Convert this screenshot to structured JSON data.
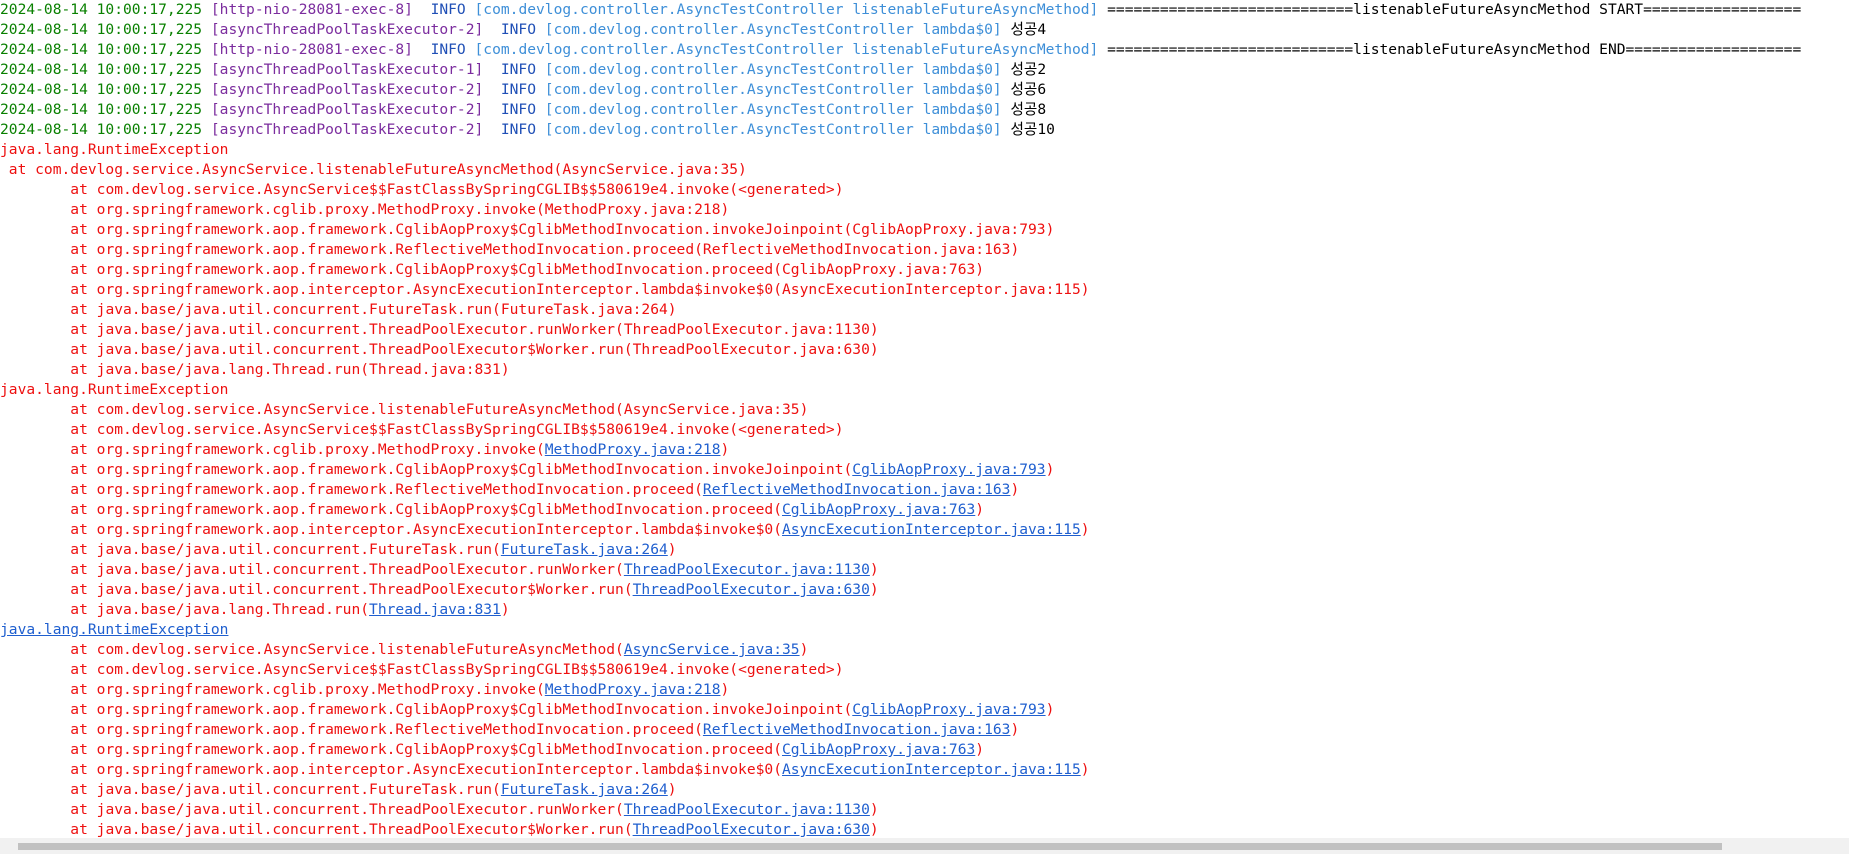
{
  "log": [
    {
      "ts": "2024-08-14 10:00:17,225",
      "thread": "[http-nio-28081-exec-8]",
      "level": "INFO",
      "logger": "[com.devlog.controller.AsyncTestController listenableFutureAsyncMethod]",
      "msg": "============================listenableFutureAsyncMethod START=================="
    },
    {
      "ts": "2024-08-14 10:00:17,225",
      "thread": "[asyncThreadPoolTaskExecutor-2]",
      "level": "INFO",
      "logger": "[com.devlog.controller.AsyncTestController lambda$0]",
      "msg": "성공4"
    },
    {
      "ts": "2024-08-14 10:00:17,225",
      "thread": "[http-nio-28081-exec-8]",
      "level": "INFO",
      "logger": "[com.devlog.controller.AsyncTestController listenableFutureAsyncMethod]",
      "msg": "============================listenableFutureAsyncMethod END===================="
    },
    {
      "ts": "2024-08-14 10:00:17,225",
      "thread": "[asyncThreadPoolTaskExecutor-1]",
      "level": "INFO",
      "logger": "[com.devlog.controller.AsyncTestController lambda$0]",
      "msg": "성공2"
    },
    {
      "ts": "2024-08-14 10:00:17,225",
      "thread": "[asyncThreadPoolTaskExecutor-2]",
      "level": "INFO",
      "logger": "[com.devlog.controller.AsyncTestController lambda$0]",
      "msg": "성공6"
    },
    {
      "ts": "2024-08-14 10:00:17,225",
      "thread": "[asyncThreadPoolTaskExecutor-2]",
      "level": "INFO",
      "logger": "[com.devlog.controller.AsyncTestController lambda$0]",
      "msg": "성공8"
    },
    {
      "ts": "2024-08-14 10:00:17,225",
      "thread": "[asyncThreadPoolTaskExecutor-2]",
      "level": "INFO",
      "logger": "[com.devlog.controller.AsyncTestController lambda$0]",
      "msg": "성공10"
    }
  ],
  "trace1": {
    "exception": "java.lang.RuntimeException",
    "first": " at com.devlog.service.AsyncService.listenableFutureAsyncMethod(AsyncService.java:35)",
    "frames": [
      {
        "method": "com.devlog.service.AsyncService$$FastClassBySpringCGLIB$$580619e4.invoke",
        "loc": "<generated>"
      },
      {
        "method": "org.springframework.cglib.proxy.MethodProxy.invoke",
        "loc": "MethodProxy.java:218"
      },
      {
        "method": "org.springframework.aop.framework.CglibAopProxy$CglibMethodInvocation.invokeJoinpoint",
        "loc": "CglibAopProxy.java:793"
      },
      {
        "method": "org.springframework.aop.framework.ReflectiveMethodInvocation.proceed",
        "loc": "ReflectiveMethodInvocation.java:163"
      },
      {
        "method": "org.springframework.aop.framework.CglibAopProxy$CglibMethodInvocation.proceed",
        "loc": "CglibAopProxy.java:763"
      },
      {
        "method": "org.springframework.aop.interceptor.AsyncExecutionInterceptor.lambda$invoke$0",
        "loc": "AsyncExecutionInterceptor.java:115"
      },
      {
        "method": "java.base/java.util.concurrent.FutureTask.run",
        "loc": "FutureTask.java:264"
      },
      {
        "method": "java.base/java.util.concurrent.ThreadPoolExecutor.runWorker",
        "loc": "ThreadPoolExecutor.java:1130"
      },
      {
        "method": "java.base/java.util.concurrent.ThreadPoolExecutor$Worker.run",
        "loc": "ThreadPoolExecutor.java:630"
      },
      {
        "method": "java.base/java.lang.Thread.run",
        "loc": "Thread.java:831"
      }
    ]
  },
  "trace2": {
    "exception": "java.lang.RuntimeException",
    "frames": [
      {
        "method": "com.devlog.service.AsyncService.listenableFutureAsyncMethod",
        "loc": "AsyncService.java:35"
      },
      {
        "method": "com.devlog.service.AsyncService$$FastClassBySpringCGLIB$$580619e4.invoke",
        "loc": "<generated>"
      },
      {
        "method": "org.springframework.cglib.proxy.MethodProxy.invoke",
        "loc": "MethodProxy.java:218"
      },
      {
        "method": "org.springframework.aop.framework.CglibAopProxy$CglibMethodInvocation.invokeJoinpoint",
        "loc": "CglibAopProxy.java:793"
      },
      {
        "method": "org.springframework.aop.framework.ReflectiveMethodInvocation.proceed",
        "loc": "ReflectiveMethodInvocation.java:163"
      },
      {
        "method": "org.springframework.aop.framework.CglibAopProxy$CglibMethodInvocation.proceed",
        "loc": "CglibAopProxy.java:763"
      },
      {
        "method": "org.springframework.aop.interceptor.AsyncExecutionInterceptor.lambda$invoke$0",
        "loc": "AsyncExecutionInterceptor.java:115"
      },
      {
        "method": "java.base/java.util.concurrent.FutureTask.run",
        "loc": "FutureTask.java:264"
      },
      {
        "method": "java.base/java.util.concurrent.ThreadPoolExecutor.runWorker",
        "loc": "ThreadPoolExecutor.java:1130"
      },
      {
        "method": "java.base/java.util.concurrent.ThreadPoolExecutor$Worker.run",
        "loc": "ThreadPoolExecutor.java:630"
      },
      {
        "method": "java.base/java.lang.Thread.run",
        "loc": "Thread.java:831"
      }
    ]
  },
  "trace3": {
    "exception": "java.lang.RuntimeException",
    "frames": [
      {
        "method": "com.devlog.service.AsyncService.listenableFutureAsyncMethod",
        "loc": "AsyncService.java:35"
      },
      {
        "method": "com.devlog.service.AsyncService$$FastClassBySpringCGLIB$$580619e4.invoke",
        "loc": "<generated>"
      },
      {
        "method": "org.springframework.cglib.proxy.MethodProxy.invoke",
        "loc": "MethodProxy.java:218"
      },
      {
        "method": "org.springframework.aop.framework.CglibAopProxy$CglibMethodInvocation.invokeJoinpoint",
        "loc": "CglibAopProxy.java:793"
      },
      {
        "method": "org.springframework.aop.framework.ReflectiveMethodInvocation.proceed",
        "loc": "ReflectiveMethodInvocation.java:163"
      },
      {
        "method": "org.springframework.aop.framework.CglibAopProxy$CglibMethodInvocation.proceed",
        "loc": "CglibAopProxy.java:763"
      },
      {
        "method": "org.springframework.aop.interceptor.AsyncExecutionInterceptor.lambda$invoke$0",
        "loc": "AsyncExecutionInterceptor.java:115"
      },
      {
        "method": "java.base/java.util.concurrent.FutureTask.run",
        "loc": "FutureTask.java:264"
      },
      {
        "method": "java.base/java.util.concurrent.ThreadPoolExecutor.runWorker",
        "loc": "ThreadPoolExecutor.java:1130"
      },
      {
        "method": "java.base/java.util.concurrent.ThreadPoolExecutor$Worker.run",
        "loc": "ThreadPoolExecutor.java:630"
      }
    ]
  },
  "text": {
    "at_prefix": "        at ",
    "open_paren": "(",
    "close_paren": ")",
    "space": " ",
    "sep": "  "
  },
  "colors": {
    "timestamp": "#098000",
    "thread": "#7b2c9e",
    "level": "#1f4fb6",
    "logger": "#3e8fd8",
    "error": "#ee1010",
    "link": "#1f5fcf"
  }
}
